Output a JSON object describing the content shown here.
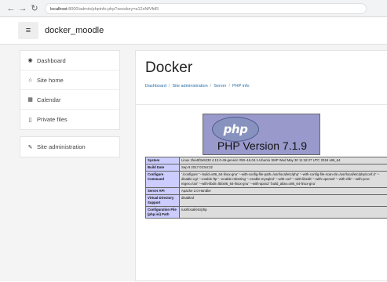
{
  "browser": {
    "url_host": "localhost",
    "url_rest": ":8000/admin/phpinfo.php?sesskey=a12sNfVfdR"
  },
  "navbar": {
    "site_name": "docker_moodle"
  },
  "sidebar": {
    "items": [
      {
        "label": "Dashboard",
        "icon": "dashboard-icon",
        "glyph": "◉"
      },
      {
        "label": "Site home",
        "icon": "home-icon",
        "glyph": "⌂"
      },
      {
        "label": "Calendar",
        "icon": "calendar-icon",
        "glyph": "▦"
      },
      {
        "label": "Private files",
        "icon": "file-icon",
        "glyph": "▯"
      }
    ],
    "admin_item": {
      "label": "Site administration",
      "icon": "wrench-icon",
      "glyph": "✎"
    }
  },
  "page": {
    "title": "Docker",
    "breadcrumbs": [
      "Dashboard",
      "Site administration",
      "Server",
      "PHP info"
    ]
  },
  "phpinfo": {
    "logo_text": "php",
    "version": "PHP Version 7.1.9",
    "rows": [
      {
        "key": "System",
        "value": "Linux 1fee5f3e5230 4.13.0-45-generic #50~16.04.1-Ubuntu SMP Wed May 30 11:18:27 UTC 2018 x86_64"
      },
      {
        "key": "Build Date",
        "value": "Sep 9 2017 02:54:32"
      },
      {
        "key": "Configure Command",
        "value": "'./configure' '--build=x86_64-linux-gnu' '--with-config-file-path=/usr/local/etc/php' '--with-config-file-scan-dir=/usr/local/etc/php/conf.d' '--disable-cgi' '--enable-ftp' '--enable-mbstring' '--enable-mysqlnd' '--with-curl' '--with-libedit' '--with-openssl' '--with-zlib' '--with-pcre-regex=/usr' '--with-libdir=lib/x86_64-linux-gnu' '--with-apxs2' 'build_alias=x86_64-linux-gnu'"
      },
      {
        "key": "Server API",
        "value": "Apache 2.0 Handler"
      },
      {
        "key": "Virtual Directory Support",
        "value": "disabled"
      },
      {
        "key": "Configuration File (php.ini) Path",
        "value": "/usr/local/etc/php"
      }
    ]
  }
}
